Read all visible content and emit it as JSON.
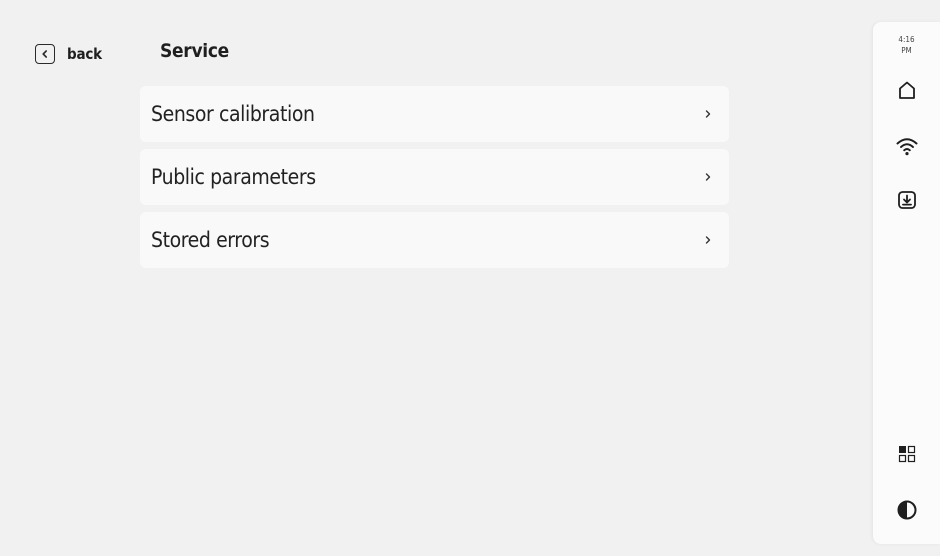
{
  "header": {
    "back_label": "back",
    "title": "Service"
  },
  "menu": {
    "items": [
      {
        "label": "Sensor calibration",
        "icon": "chevron-right-icon"
      },
      {
        "label": "Public parameters",
        "icon": "chevron-right-icon"
      },
      {
        "label": "Stored errors",
        "icon": "chevron-right-icon"
      }
    ]
  },
  "sidebar": {
    "time": "4:16",
    "ampm": "PM",
    "icons": [
      "home-icon",
      "wifi-icon",
      "download-icon",
      "layout-grid-icon",
      "contrast-icon"
    ]
  },
  "colors": {
    "background": "#f1f1f1",
    "card": "#f9f9f9",
    "sidebar": "#fbfbfb",
    "text": "#222222"
  }
}
